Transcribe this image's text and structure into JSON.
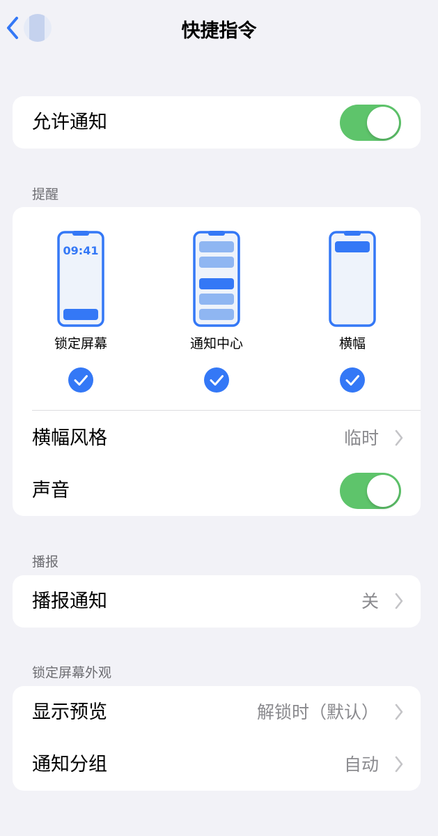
{
  "nav": {
    "title": "快捷指令",
    "back_icon": "chevron-left-icon",
    "app_icon": "app-icon"
  },
  "allow": {
    "label": "允许通知",
    "toggle_on": true
  },
  "alerts": {
    "section": "提醒",
    "options": [
      {
        "label": "锁定屏幕",
        "time": "09:41",
        "checked": true
      },
      {
        "label": "通知中心",
        "checked": true
      },
      {
        "label": "横幅",
        "checked": true
      }
    ],
    "banner_style": {
      "label": "横幅风格",
      "value": "临时"
    },
    "sounds": {
      "label": "声音",
      "toggle_on": true
    }
  },
  "announce": {
    "section": "播报",
    "row": {
      "label": "播报通知",
      "value": "关"
    }
  },
  "lockscreen": {
    "section": "锁定屏幕外观",
    "preview": {
      "label": "显示预览",
      "value": "解锁时（默认）"
    },
    "grouping": {
      "label": "通知分组",
      "value": "自动"
    }
  },
  "colors": {
    "accent": "#3478f6",
    "toggle": "#5ec46b",
    "background": "#f2f2f7"
  }
}
